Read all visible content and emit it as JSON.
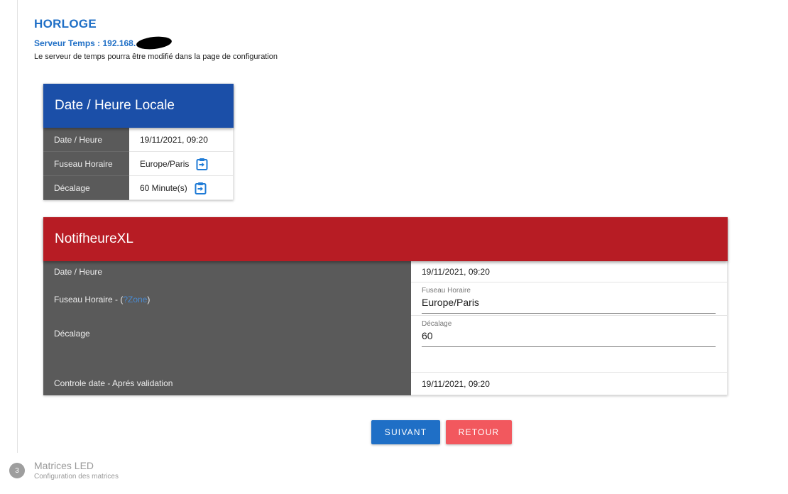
{
  "header": {
    "title": "HORLOGE",
    "server_label": "Serveur Temps : 192.168.",
    "description": "Le serveur de temps pourra être modifié dans la page de configuration"
  },
  "local_card": {
    "title": "Date / Heure Locale",
    "rows": [
      {
        "label": "Date / Heure",
        "value": "19/11/2021, 09:20"
      },
      {
        "label": "Fuseau Horaire",
        "value": "Europe/Paris"
      },
      {
        "label": "Décalage",
        "value": "60 Minute(s)"
      }
    ]
  },
  "device_card": {
    "title": "NotifheureXL",
    "date_label": "Date / Heure",
    "date_value": "19/11/2021, 09:20",
    "timezone_label": "Fuseau Horaire - (",
    "timezone_link": "?Zone",
    "timezone_label_end": ")",
    "timezone_field_label": "Fuseau Horaire",
    "timezone_field_value": "Europe/Paris",
    "offset_label": "Décalage",
    "offset_field_label": "Décalage",
    "offset_field_value": "60",
    "control_label": "Controle date - Aprés validation",
    "control_value": "19/11/2021, 09:20"
  },
  "buttons": {
    "next": "SUIVANT",
    "back": "RETOUR"
  },
  "next_step": {
    "number": "3",
    "title": "Matrices LED",
    "subtitle": "Configuration des matrices"
  },
  "colors": {
    "accent_blue": "#1f6fc6",
    "local_header": "#1b4fa8",
    "device_header": "#b71c24",
    "back_button": "#f2585e"
  },
  "icons": {
    "copy_action": "clipboard-arrow-icon"
  }
}
